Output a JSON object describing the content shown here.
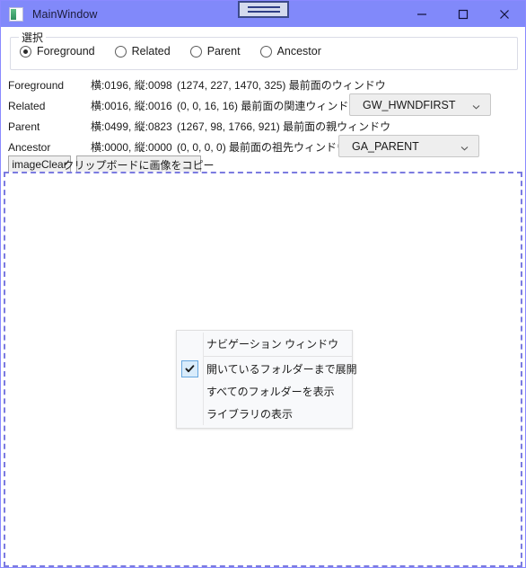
{
  "window": {
    "title": "MainWindow",
    "icon": "app-window-icon",
    "titlebar_color": "#8189fa",
    "controls": [
      {
        "name": "minimize",
        "glyph": "minimize-icon"
      },
      {
        "name": "maximize",
        "glyph": "maximize-icon"
      },
      {
        "name": "close",
        "glyph": "close-icon"
      }
    ]
  },
  "snap_widget": {
    "name": "snap-layout-indicator",
    "lines": 2
  },
  "groupbox": {
    "legend": "選択",
    "radios": [
      {
        "label": "Foreground",
        "checked": true
      },
      {
        "label": "Related",
        "checked": false
      },
      {
        "label": "Parent",
        "checked": false
      },
      {
        "label": "Ancestor",
        "checked": false
      }
    ]
  },
  "rows": [
    {
      "name": "Foreground",
      "size": "横:0196, 縦:0098",
      "rect": "(1274, 227, 1470, 325) 最前面のウィンドウ",
      "combo": null
    },
    {
      "name": "Related",
      "size": "横:0016, 縦:0016",
      "rect": "(0, 0, 16, 16) 最前面の関連ウィンドウ",
      "combo": {
        "value": "GW_HWNDFIRST",
        "variant": "combo-1"
      }
    },
    {
      "name": "Parent",
      "size": "横:0499, 縦:0823",
      "rect": "(1267, 98, 1766, 921) 最前面の親ウィンドウ",
      "combo": null
    },
    {
      "name": "Ancestor",
      "size": "横:0000, 縦:0000",
      "rect": "(0, 0, 0, 0) 最前面の祖先ウィンドウ",
      "combo": {
        "value": "GA_PARENT",
        "variant": "combo-2"
      }
    }
  ],
  "buttons": {
    "clear": "imageClear",
    "copy": "クリップボードに画像をコピー"
  },
  "context_menu": {
    "items": [
      {
        "label": "ナビゲーション ウィンドウ",
        "checked": false,
        "separator_after": true
      },
      {
        "label": "開いているフォルダーまで展開",
        "checked": true,
        "separator_after": false
      },
      {
        "label": "すべてのフォルダーを表示",
        "checked": false,
        "separator_after": false
      },
      {
        "label": "ライブラリの表示",
        "checked": false,
        "separator_after": false
      }
    ],
    "check_glyph": "check-icon",
    "check_color": "#66a7e0"
  },
  "colors": {
    "titlebar": "#8189fa",
    "dashed_border": "#7b7be0",
    "combo_bg": "#eeeeee",
    "button_bg": "#efefef"
  }
}
